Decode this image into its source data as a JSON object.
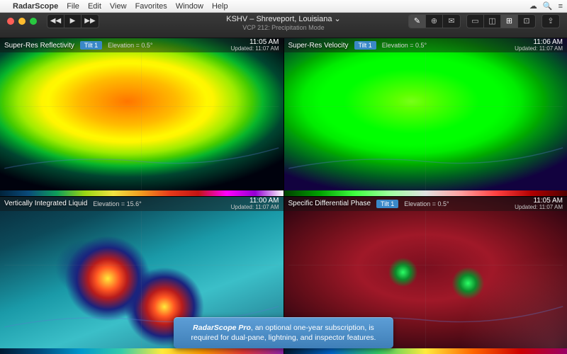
{
  "menubar": {
    "app": "RadarScope",
    "items": [
      "File",
      "Edit",
      "View",
      "Favorites",
      "Window",
      "Help"
    ]
  },
  "menubar_right": {
    "cloud": "☁",
    "search": "🔍",
    "menu": "≡"
  },
  "window": {
    "title": "KSHV – Shreveport, Louisiana ⌄",
    "subtitle": "VCP 212: Precipitation Mode"
  },
  "playback": {
    "rewind": "◀◀",
    "play": "▶",
    "forward": "▶▶"
  },
  "toolbar_right": {
    "group1": [
      "✎",
      "⊕",
      "✉"
    ],
    "group2": [
      "▭",
      "◫",
      "⊞",
      "⊡"
    ],
    "share": "⇪"
  },
  "panes": [
    {
      "product": "Super-Res Reflectivity",
      "tilt": "Tilt 1",
      "elevation": "Elevation = 0.5°",
      "time": "11:05 AM",
      "updated": "Updated: 11:07 AM"
    },
    {
      "product": "Super-Res Velocity",
      "tilt": "Tilt 1",
      "elevation": "Elevation = 0.5°",
      "time": "11:06 AM",
      "updated": "Updated: 11:07 AM"
    },
    {
      "product": "Vertically Integrated Liquid",
      "tilt": "",
      "elevation": "Elevation = 15.6°",
      "time": "11:00 AM",
      "updated": "Updated: 11:07 AM"
    },
    {
      "product": "Specific Differential Phase",
      "tilt": "Tilt 1",
      "elevation": "Elevation = 0.5°",
      "time": "11:05 AM",
      "updated": "Updated: 11:07 AM"
    }
  ],
  "promo": {
    "emphasis": "RadarScope Pro",
    "rest": ", an optional one-year subscription, is required for dual-pane, lightning, and inspector features."
  }
}
